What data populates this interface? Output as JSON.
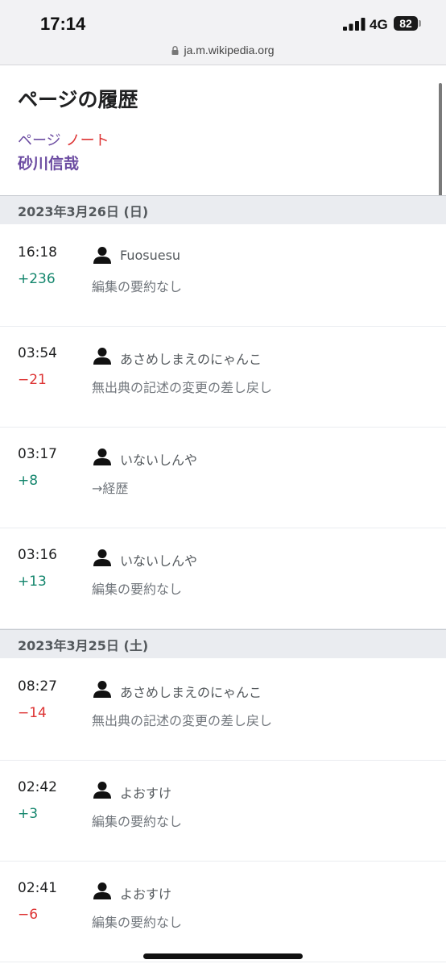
{
  "status_bar": {
    "time": "17:14",
    "network": "4G",
    "battery": "82",
    "url": "ja.m.wikipedia.org"
  },
  "page": {
    "title": "ページの履歴",
    "tab_page": "ページ",
    "tab_talk": "ノート",
    "article": "砂川信哉"
  },
  "colors": {
    "visited_link": "#6b4ba1",
    "new_link": "#d33",
    "positive": "#14866d",
    "negative": "#d33"
  },
  "groups": [
    {
      "date": "2023年3月26日 (日)",
      "entries": [
        {
          "time": "16:18",
          "delta": "+236",
          "sign": "pos",
          "user": "Fuosuesu",
          "summary": "編集の要約なし"
        },
        {
          "time": "03:54",
          "delta": "−21",
          "sign": "neg",
          "user": "あさめしまえのにゃんこ",
          "summary": "無出典の記述の変更の差し戻し"
        },
        {
          "time": "03:17",
          "delta": "+8",
          "sign": "pos",
          "user": "いないしんや",
          "summary": "→経歴"
        },
        {
          "time": "03:16",
          "delta": "+13",
          "sign": "pos",
          "user": "いないしんや",
          "summary": "編集の要約なし"
        }
      ]
    },
    {
      "date": "2023年3月25日 (土)",
      "entries": [
        {
          "time": "08:27",
          "delta": "−14",
          "sign": "neg",
          "user": "あさめしまえのにゃんこ",
          "summary": "無出典の記述の変更の差し戻し"
        },
        {
          "time": "02:42",
          "delta": "+3",
          "sign": "pos",
          "user": "よおすけ",
          "summary": "編集の要約なし"
        },
        {
          "time": "02:41",
          "delta": "−6",
          "sign": "neg",
          "user": "よおすけ",
          "summary": "編集の要約なし"
        }
      ]
    }
  ]
}
